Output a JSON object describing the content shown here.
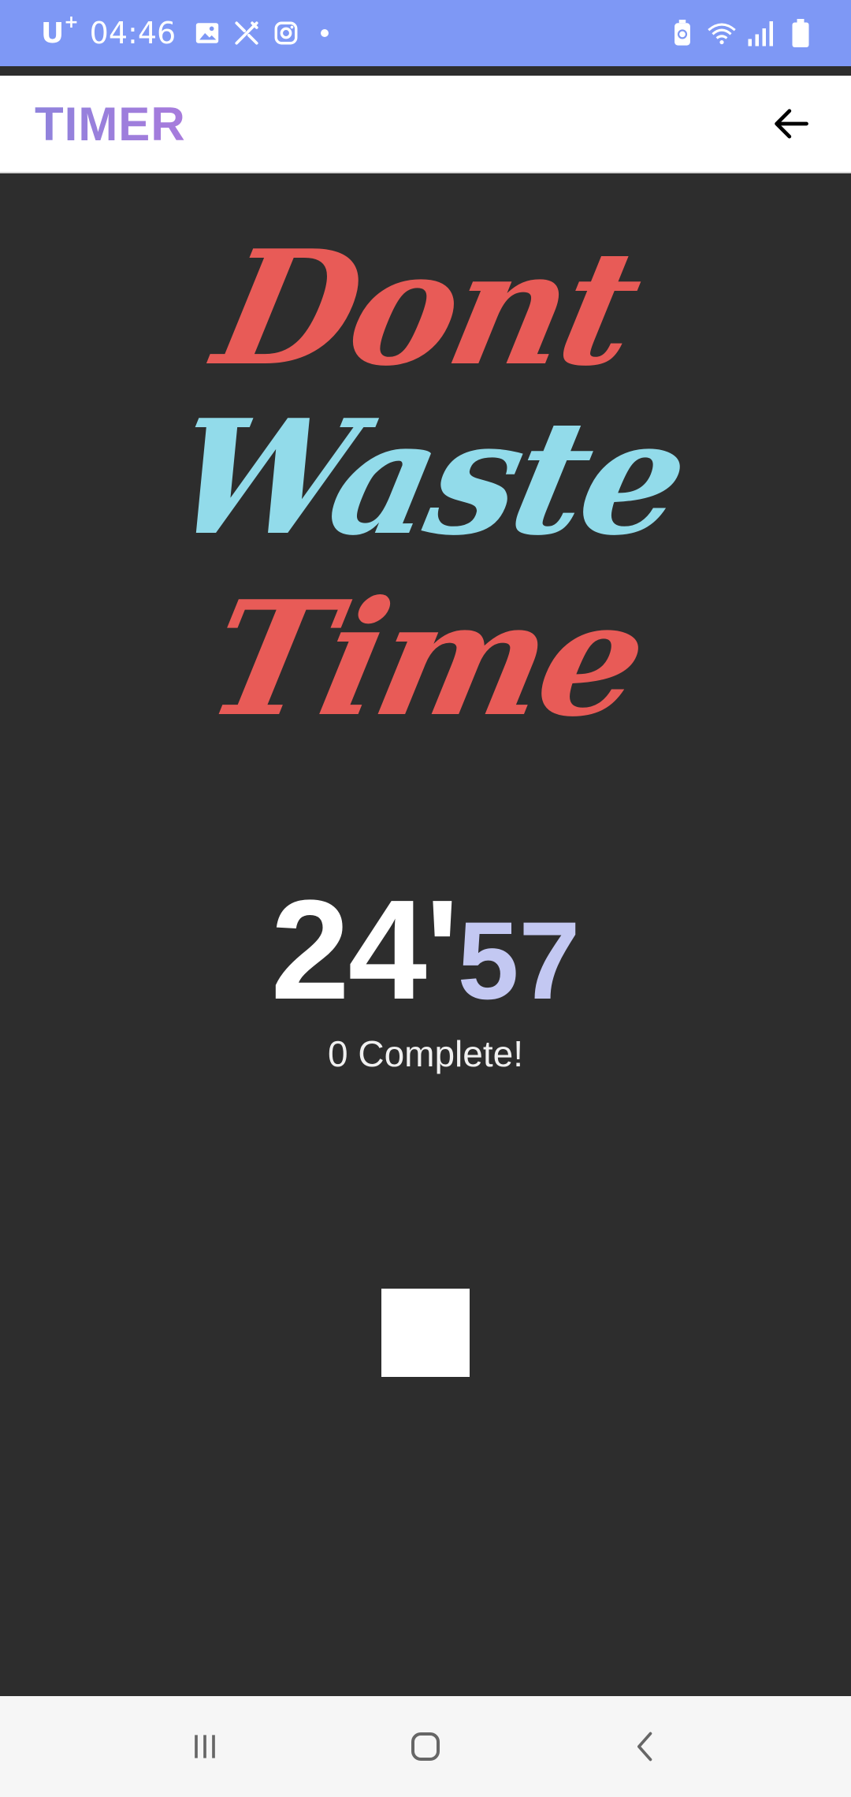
{
  "status_bar": {
    "carrier": "U",
    "carrier_sup": "+",
    "time": "04:46",
    "left_icons": [
      "gallery-icon",
      "tools-icon",
      "instagram-icon",
      "notification-dot"
    ],
    "right_icons": [
      "battery-saver-icon",
      "wifi-icon",
      "signal-icon",
      "battery-icon"
    ],
    "background": "#7e98f5"
  },
  "app_bar": {
    "title": "TIMER",
    "back_icon": "arrow-left-icon"
  },
  "slogan": {
    "line1": "Dont",
    "line2": "Waste",
    "line3": "Time",
    "colors": {
      "line1": "#e85b57",
      "line2": "#92dbea",
      "line3": "#e85b57"
    }
  },
  "timer": {
    "minutes": "24'",
    "seconds": "57",
    "complete_text": "0 Complete!"
  },
  "controls": {
    "stop_icon": "stop-icon"
  },
  "nav_bar": {
    "items": [
      "recents-icon",
      "home-icon",
      "back-icon"
    ]
  }
}
